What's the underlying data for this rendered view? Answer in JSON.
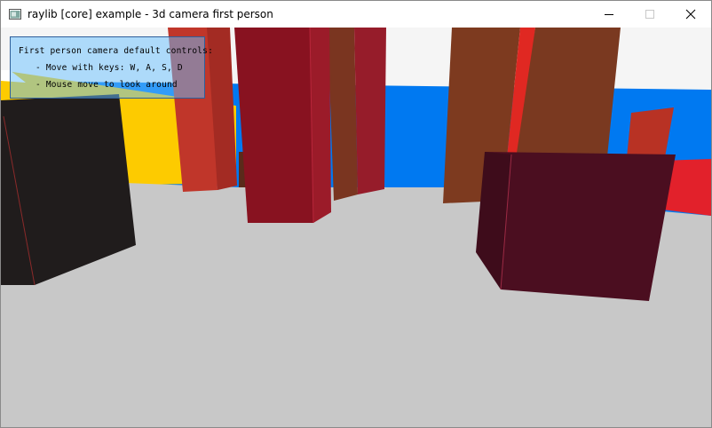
{
  "window": {
    "title": "raylib [core] example - 3d camera first person",
    "app_icon": "raylib-window-icon"
  },
  "window_controls": {
    "minimize": "minimize-icon",
    "maximize": "maximize-icon",
    "close": "close-icon"
  },
  "hud": {
    "heading": "First person camera default controls:",
    "line1": "- Move with keys: W, A, S, D",
    "line2": "- Mouse move to look around"
  },
  "colors": {
    "sky": "#f5f5f5",
    "ground": "#c8c8c8",
    "wall_blue": "#0079f1",
    "wall_yellow": "#fdcb00",
    "hud_fill": "#66bfff",
    "hud_border": "#2f5f9a"
  }
}
